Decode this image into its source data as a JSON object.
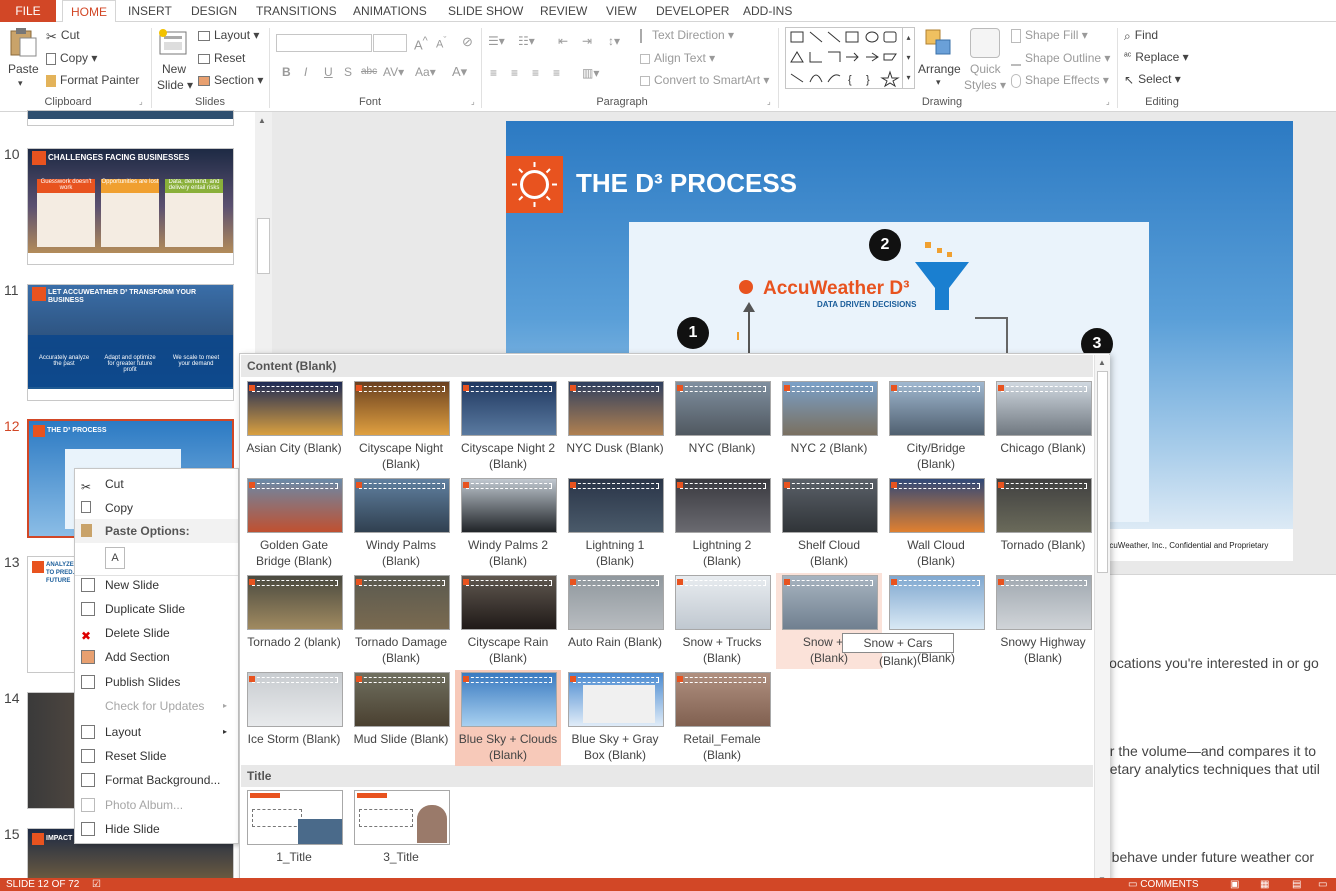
{
  "tabs": {
    "file": "FILE",
    "items": [
      "HOME",
      "INSERT",
      "DESIGN",
      "TRANSITIONS",
      "ANIMATIONS",
      "SLIDE SHOW",
      "REVIEW",
      "VIEW",
      "DEVELOPER",
      "ADD-INS"
    ]
  },
  "ribbon": {
    "clipboard": {
      "paste": "Paste",
      "cut": "Cut",
      "copy": "Copy",
      "format_painter": "Format Painter",
      "label": "Clipboard"
    },
    "slides": {
      "new_slide_1": "New",
      "new_slide_2": "Slide",
      "layout": "Layout",
      "reset": "Reset",
      "section": "Section",
      "label": "Slides"
    },
    "font": {
      "label": "Font",
      "b": "B",
      "i": "I",
      "u": "U",
      "s": "S",
      "abc": "abc",
      "av": "AV",
      "aa": "Aa",
      "a": "A"
    },
    "paragraph": {
      "text_direction": "Text Direction",
      "align_text": "Align Text",
      "convert_smartart": "Convert to SmartArt",
      "label": "Paragraph"
    },
    "drawing": {
      "arrange": "Arrange",
      "quick_styles_1": "Quick",
      "quick_styles_2": "Styles",
      "shape_fill": "Shape Fill",
      "shape_outline": "Shape Outline",
      "shape_effects": "Shape Effects",
      "label": "Drawing"
    },
    "editing": {
      "find": "Find",
      "replace": "Replace",
      "select": "Select",
      "label": "Editing"
    }
  },
  "thumbnails": {
    "numbers": [
      "10",
      "11",
      "12",
      "13",
      "14",
      "15"
    ],
    "s10": {
      "title": "CHALLENGES FACING BUSINESSES",
      "c1": "Guesswork doesn't work",
      "c2": "Opportunities are lost",
      "c3": "Data, demand, and delivery entail risks"
    },
    "s11": {
      "title": "LET ACCUWEATHER D³ TRANSFORM YOUR BUSINESS",
      "c1": "Accurately analyze the past",
      "c2": "Adapt and optimize for greater future profit",
      "c3": "We scale to meet your demand"
    },
    "s12": {
      "title": "THE D³ PROCESS"
    },
    "s13": {
      "title": "ANALYZE ... TO PRED... FUTURE"
    },
    "s15": {
      "title": "IMPACT INDICATOR™"
    }
  },
  "slide": {
    "title": "THE D³ PROCESS",
    "logo": "AccuWeather D³",
    "tagline": "DATA DRIVEN DECISIONS",
    "step1": "1",
    "step2": "2",
    "step3": "3",
    "footer": "AccuWeather, Inc., Confidential and Proprietary"
  },
  "notes": {
    "line1": "locations you're interested in or go",
    "line2": "er the volume—and compares it to",
    "line3": "rietary analytics techniques that util",
    "line4": "o behave under future weather cor"
  },
  "context_menu": {
    "cut": "Cut",
    "copy": "Copy",
    "paste_options": "Paste Options:",
    "new_slide": "New Slide",
    "duplicate_slide": "Duplicate Slide",
    "delete_slide": "Delete Slide",
    "add_section": "Add Section",
    "publish_slides": "Publish Slides",
    "check_updates": "Check for Updates",
    "layout": "Layout",
    "reset_slide": "Reset Slide",
    "format_background": "Format Background...",
    "photo_album": "Photo Album...",
    "hide_slide": "Hide Slide"
  },
  "gallery": {
    "section_content": "Content (Blank)",
    "section_title": "Title",
    "layouts": [
      [
        "Asian City (Blank)",
        ""
      ],
      [
        "Cityscape Night",
        "(Blank)"
      ],
      [
        "Cityscape Night 2",
        "(Blank)"
      ],
      [
        "NYC Dusk (Blank)",
        ""
      ],
      [
        "NYC (Blank)",
        ""
      ],
      [
        "NYC 2 (Blank)",
        ""
      ],
      [
        "City/Bridge",
        "(Blank)"
      ],
      [
        "Chicago (Blank)",
        ""
      ],
      [
        "Golden Gate",
        "Bridge (Blank)"
      ],
      [
        "Windy Palms",
        "(Blank)"
      ],
      [
        "Windy Palms 2",
        "(Blank)"
      ],
      [
        "Lightning 1",
        "(Blank)"
      ],
      [
        "Lightning 2",
        "(Blank)"
      ],
      [
        "Shelf Cloud",
        "(Blank)"
      ],
      [
        "Wall Cloud",
        "(Blank)"
      ],
      [
        "Tornado (Blank)",
        ""
      ],
      [
        "Tornado 2 (blank)",
        ""
      ],
      [
        "Tornado Damage",
        "(Blank)"
      ],
      [
        "Cityscape Rain",
        "(Blank)"
      ],
      [
        "Auto Rain (Blank)",
        ""
      ],
      [
        "Snow + Trucks",
        "(Blank)"
      ],
      [
        "Snow + C",
        "(Blank)"
      ],
      [
        "rs",
        "(Blank)"
      ],
      [
        "Snowy Highway",
        "(Blank)"
      ],
      [
        "Ice Storm (Blank)",
        ""
      ],
      [
        "Mud Slide (Blank)",
        ""
      ],
      [
        "Blue Sky + Clouds",
        "(Blank)"
      ],
      [
        "Blue Sky + Gray",
        "Box (Blank)"
      ],
      [
        "Retail_Female",
        "(Blank)"
      ]
    ],
    "title_layouts": [
      "1_Title",
      "3_Title"
    ],
    "tooltip": "Snow + Cars (Blank)"
  },
  "status": {
    "slide_of": "SLIDE 12 OF 72",
    "comments": "COMMENTS"
  },
  "colors": {
    "accent": "#d24726",
    "selected_tile": "#f7c9b9"
  }
}
